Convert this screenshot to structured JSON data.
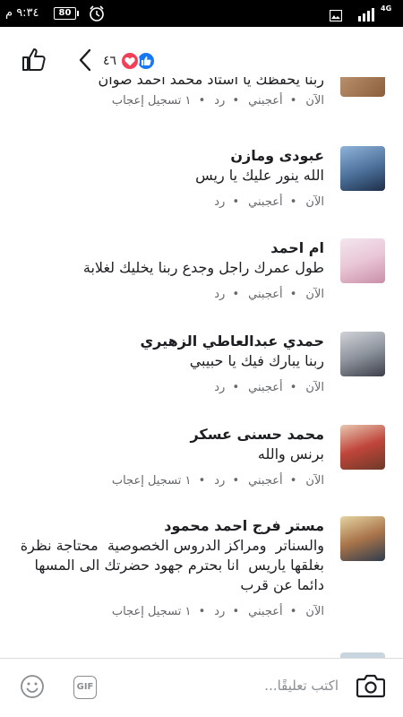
{
  "status_bar": {
    "time": "٩:٣٤ م",
    "battery": "80",
    "network": "4G"
  },
  "header": {
    "reaction_count": "٤٦",
    "icons": [
      "like-icon",
      "back-chevron-icon",
      "love-reaction-icon",
      "like-reaction-icon"
    ]
  },
  "comments": [
    {
      "author": "",
      "text": "ربنا يحفظك يا استاذ محمد احمد صوان",
      "actions": {
        "time": "الآن",
        "like": "أعجبني",
        "reply": "رد",
        "likes_count": "١ تسجيل إعجاب"
      }
    },
    {
      "author": "عبودى ومازن",
      "text": "الله ينور عليك يا ريس",
      "actions": {
        "time": "الآن",
        "like": "أعجبني",
        "reply": "رد",
        "likes_count": ""
      }
    },
    {
      "author": "ام احمد",
      "text": "طول عمرك راجل وجدع ربنا يخليك لغلابة",
      "actions": {
        "time": "الآن",
        "like": "أعجبني",
        "reply": "رد",
        "likes_count": ""
      }
    },
    {
      "author": "حمدي عبدالعاطي الزهيري",
      "text": "ربنا يبارك فيك يا حبيبي",
      "actions": {
        "time": "الآن",
        "like": "أعجبني",
        "reply": "رد",
        "likes_count": ""
      }
    },
    {
      "author": "محمد حسنى عسكر",
      "text": "برنس والله",
      "actions": {
        "time": "الآن",
        "like": "أعجبني",
        "reply": "رد",
        "likes_count": "١ تسجيل إعجاب"
      }
    },
    {
      "author": "مستر فرج احمد محمود",
      "text": "والسناتر  ومراكز الدروس الخصوصية  محتاجة نظرة بغلقها ياريس  انا بحترم جهود حضرتك الى المسها دائما عن قرب",
      "actions": {
        "time": "الآن",
        "like": "أعجبني",
        "reply": "رد",
        "likes_count": "١ تسجيل إعجاب"
      }
    }
  ],
  "composer": {
    "placeholder": "اكتب تعليقًا...",
    "gif_label": "GIF"
  },
  "colors": {
    "text": "#1c1e21",
    "secondary": "#65676b",
    "like_blue": "#1877f2",
    "love_red": "#f33e58"
  }
}
